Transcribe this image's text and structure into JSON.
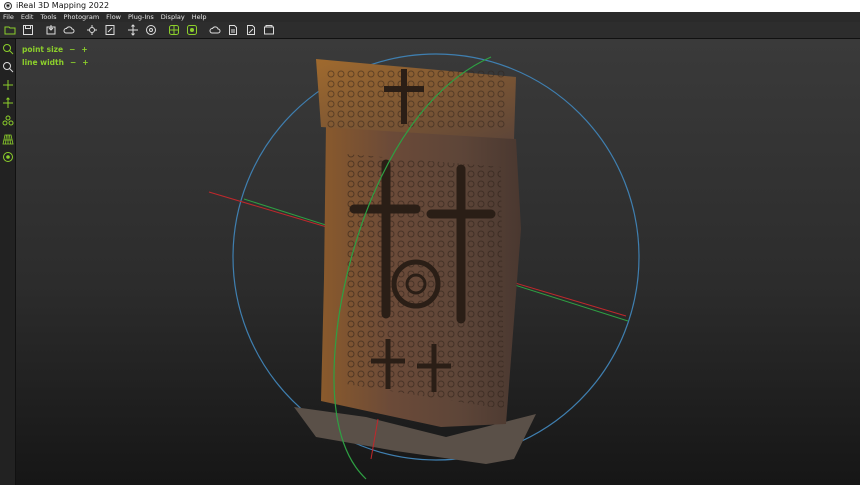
{
  "window": {
    "title": "iReal 3D Mapping 2022"
  },
  "menu": {
    "items": [
      "File",
      "Edit",
      "Tools",
      "Photogram",
      "Flow",
      "Plug-Ins",
      "Display",
      "Help"
    ]
  },
  "toolbar": {
    "icons": [
      "open-icon",
      "save-icon",
      "import-icon",
      "cloud-icon",
      "tools-icon",
      "edit-icon",
      "move-icon",
      "target-icon",
      "mesh-icon",
      "texture-icon",
      "cloud-upload-icon",
      "document-icon",
      "document-edit-icon",
      "export-icon"
    ]
  },
  "leftbar": {
    "icons": [
      "zoom-icon",
      "zoom-fit-icon",
      "pan-icon",
      "rotate-icon",
      "points-icon",
      "grid-icon",
      "view-icon"
    ]
  },
  "hud": {
    "point_size_label": "point size",
    "point_size_minus": "−",
    "point_size_plus": "+",
    "line_width_label": "line width",
    "line_width_minus": "−",
    "line_width_plus": "+"
  },
  "colors": {
    "accent": "#8ccf2b",
    "gizmo_circle": "#3f7fb0",
    "axis_x": "#c0282c",
    "axis_y": "#2ea043"
  }
}
